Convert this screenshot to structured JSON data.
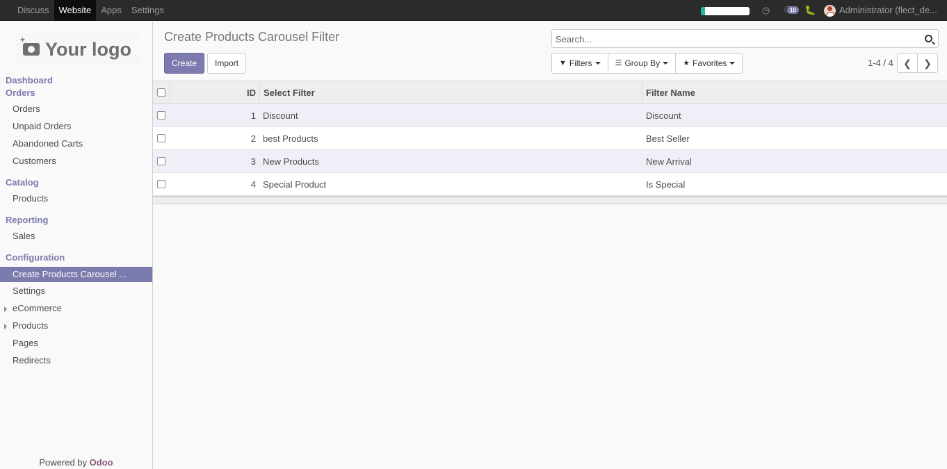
{
  "topnav": {
    "items": [
      "Discuss",
      "Website",
      "Apps",
      "Settings"
    ],
    "active": "Website",
    "progress_fraction": 0.08,
    "progress_color": "#21b799",
    "messages_badge": "10",
    "user": "Administrator (flect_de..."
  },
  "sidebar": {
    "logo_text": "Your logo",
    "sections": {
      "dashboard": "Dashboard",
      "orders": "Orders",
      "catalog": "Catalog",
      "reporting": "Reporting",
      "configuration": "Configuration"
    },
    "items": {
      "orders": "Orders",
      "unpaid": "Unpaid Orders",
      "abandoned": "Abandoned Carts",
      "customers": "Customers",
      "products": "Products",
      "sales": "Sales",
      "carousel": "Create Products Carousel ...",
      "settings": "Settings",
      "ecommerce": "eCommerce",
      "products_cfg": "Products",
      "pages": "Pages",
      "redirects": "Redirects"
    },
    "powered_prefix": "Powered by",
    "powered_brand": "Odoo"
  },
  "control": {
    "title": "Create Products Carousel Filter",
    "create_label": "Create",
    "import_label": "Import",
    "search_placeholder": "Search...",
    "filters_label": "Filters",
    "groupby_label": "Group By",
    "favorites_label": "Favorites",
    "pager": "1-4 / 4"
  },
  "table": {
    "headers": {
      "id": "ID",
      "select_filter": "Select Filter",
      "filter_name": "Filter Name"
    },
    "rows": [
      {
        "id": "1",
        "select_filter": "Discount",
        "filter_name": "Discount"
      },
      {
        "id": "2",
        "select_filter": "best Products",
        "filter_name": "Best Seller"
      },
      {
        "id": "3",
        "select_filter": "New Products",
        "filter_name": "New Arrival"
      },
      {
        "id": "4",
        "select_filter": "Special Product",
        "filter_name": "Is Special"
      }
    ]
  },
  "colors": {
    "accent": "#7c7bad",
    "topbar": "#2b2b2b",
    "brand": "#875a7b"
  }
}
